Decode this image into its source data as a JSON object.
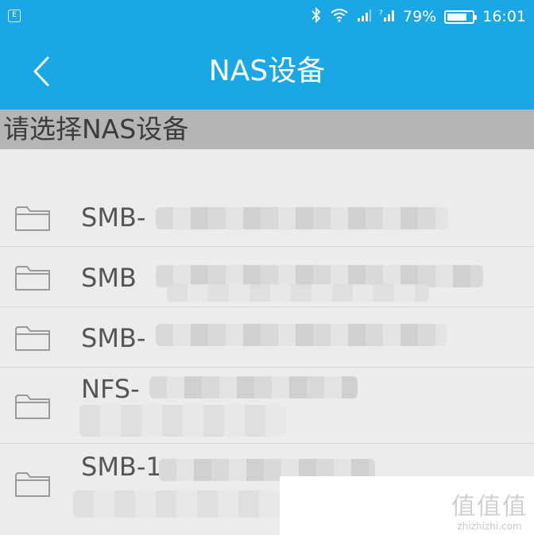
{
  "status_bar": {
    "battery": "79%",
    "battery_fraction": 0.79,
    "time": "16:01",
    "icons": [
      "bluetooth-icon",
      "wifi-icon",
      "signal-icon",
      "signal-2-icon",
      "battery-icon"
    ]
  },
  "app_bar": {
    "title": "NAS设备",
    "back_icon": "chevron-left-icon"
  },
  "section_header": "请选择NAS设备",
  "devices": [
    {
      "label": "SMB-",
      "icon": "folder-icon"
    },
    {
      "label": "SMB",
      "icon": "folder-icon"
    },
    {
      "label": "SMB-",
      "icon": "folder-icon"
    },
    {
      "label": "NFS-",
      "icon": "folder-icon"
    },
    {
      "label": "SMB-1",
      "icon": "folder-icon"
    }
  ],
  "watermark": {
    "logo": "值值值",
    "site": "zhizhizhi.com"
  },
  "colors": {
    "primary": "#1aa7e6",
    "header_bg": "#b5b5b5",
    "page_bg": "#ececec"
  }
}
